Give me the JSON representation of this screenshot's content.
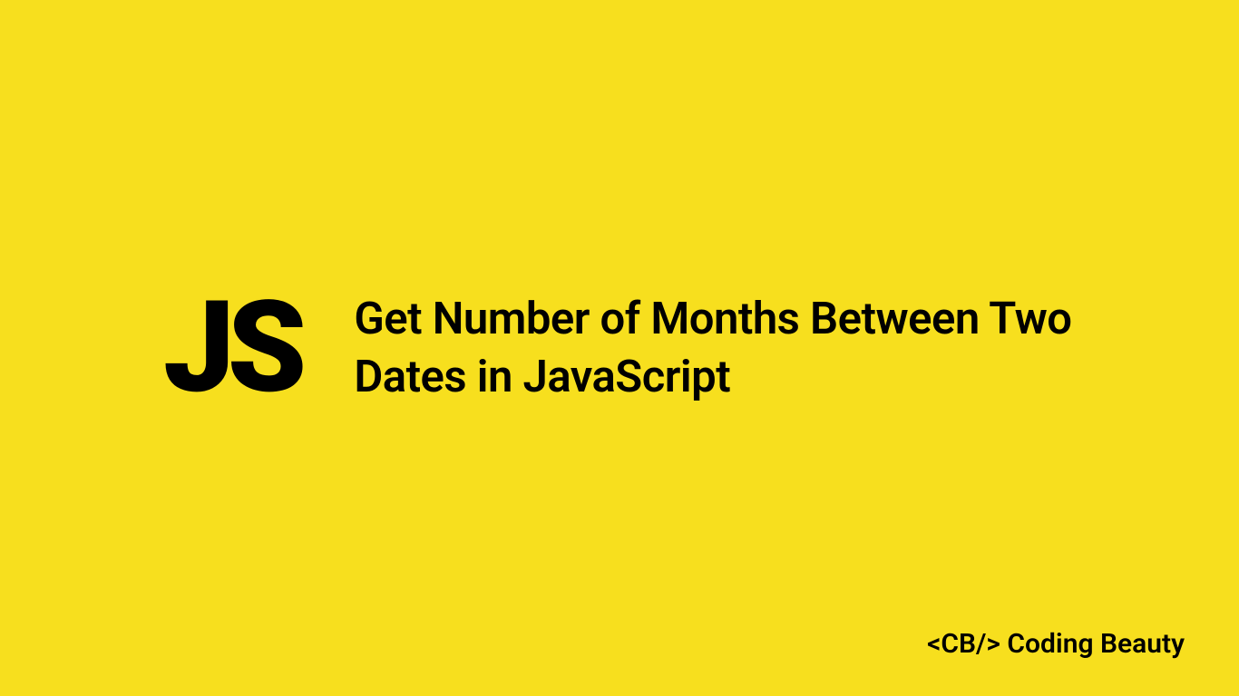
{
  "logo": "JS",
  "title": "Get Number of Months Between Two Dates in JavaScript",
  "footer": "<CB/> Coding Beauty"
}
